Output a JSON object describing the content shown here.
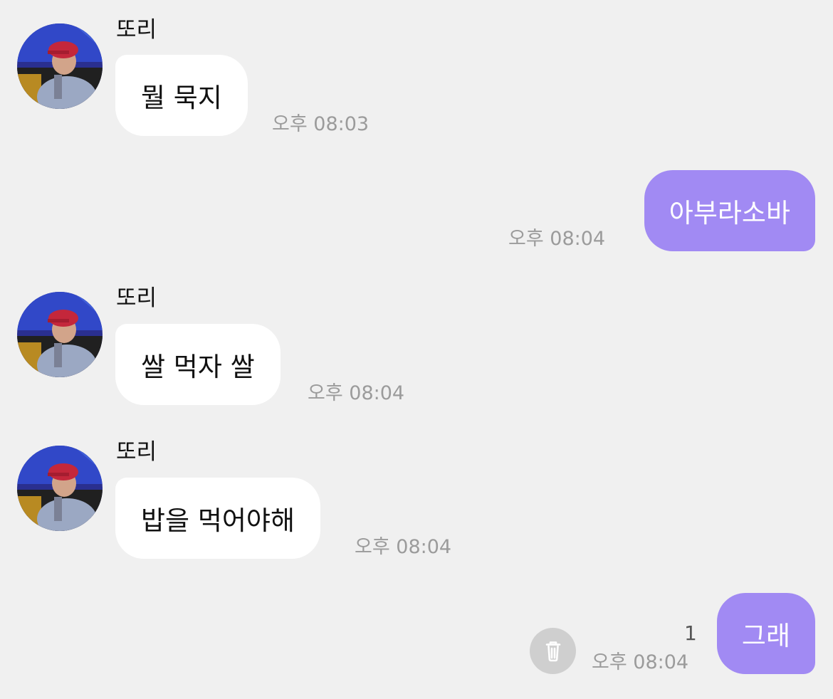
{
  "messages": [
    {
      "direction": "incoming",
      "sender": "또리",
      "text": "뭘 묵지",
      "time": "오후 08:03",
      "avatar": "profile-photo"
    },
    {
      "direction": "outgoing",
      "text": "아부라소바",
      "time": "오후 08:04"
    },
    {
      "direction": "incoming",
      "sender": "또리",
      "text": "쌀 먹자 쌀",
      "time": "오후 08:04",
      "avatar": "profile-photo"
    },
    {
      "direction": "incoming",
      "sender": "또리",
      "text": "밥을 먹어야해",
      "time": "오후 08:04",
      "avatar": "profile-photo"
    },
    {
      "direction": "outgoing",
      "text": "그래",
      "time": "오후 08:04",
      "unread_count": "1",
      "action_icon": "trash-icon"
    }
  ],
  "colors": {
    "background": "#f0f0f0",
    "incoming_bubble": "#ffffff",
    "outgoing_bubble": "#a18af3",
    "timestamp": "#9b9b9b",
    "delete_button": "#cfcfcf"
  }
}
